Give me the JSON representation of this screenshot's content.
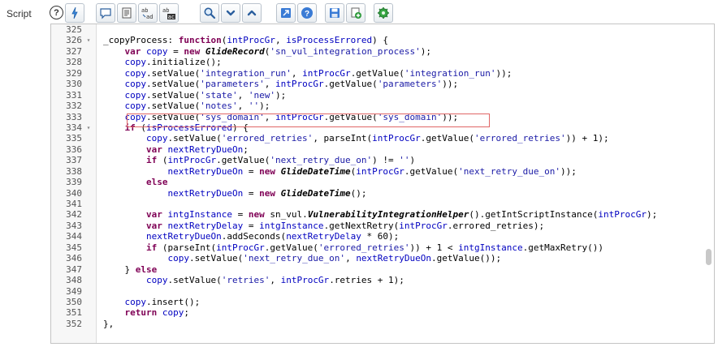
{
  "field_label": "Script",
  "toolbar": {
    "buttons": [
      {
        "name": "help-icon",
        "glyph": "?"
      },
      {
        "name": "format-code-icon"
      },
      {
        "name": "comment-icon"
      },
      {
        "name": "document-icon"
      },
      {
        "name": "replace-icon",
        "top": "ab",
        "bottom": "ad"
      },
      {
        "name": "replace-all-icon",
        "top": "ab",
        "bottom": "ac"
      },
      {
        "name": "search-icon"
      },
      {
        "name": "chevron-down-icon"
      },
      {
        "name": "chevron-up-icon"
      },
      {
        "name": "open-external-icon"
      },
      {
        "name": "help-circle-icon",
        "glyph": "?"
      },
      {
        "name": "save-icon"
      },
      {
        "name": "add-script-icon"
      },
      {
        "name": "gear-icon"
      }
    ]
  },
  "editor": {
    "highlighted_line": "333",
    "lines": [
      {
        "n": "325",
        "fold": false,
        "code": ""
      },
      {
        "n": "326",
        "fold": true,
        "code": "_copyProcess: function(intProcGr, isProcessErrored) {"
      },
      {
        "n": "327",
        "fold": false,
        "code": "    var copy = new GlideRecord('sn_vul_integration_process');"
      },
      {
        "n": "328",
        "fold": false,
        "code": "    copy.initialize();"
      },
      {
        "n": "329",
        "fold": false,
        "code": "    copy.setValue('integration_run', intProcGr.getValue('integration_run'));"
      },
      {
        "n": "330",
        "fold": false,
        "code": "    copy.setValue('parameters', intProcGr.getValue('parameters'));"
      },
      {
        "n": "331",
        "fold": false,
        "code": "    copy.setValue('state', 'new');"
      },
      {
        "n": "332",
        "fold": false,
        "code": "    copy.setValue('notes', '');"
      },
      {
        "n": "333",
        "fold": false,
        "code": "    copy.setValue('sys_domain', intProcGr.getValue('sys_domain'));"
      },
      {
        "n": "334",
        "fold": true,
        "code": "    if (isProcessErrored) {"
      },
      {
        "n": "335",
        "fold": false,
        "code": "        copy.setValue('errored_retries', parseInt(intProcGr.getValue('errored_retries')) + 1);"
      },
      {
        "n": "336",
        "fold": false,
        "code": "        var nextRetryDueOn;"
      },
      {
        "n": "337",
        "fold": false,
        "code": "        if (intProcGr.getValue('next_retry_due_on') != '')"
      },
      {
        "n": "338",
        "fold": false,
        "code": "            nextRetryDueOn = new GlideDateTime(intProcGr.getValue('next_retry_due_on'));"
      },
      {
        "n": "339",
        "fold": false,
        "code": "        else"
      },
      {
        "n": "340",
        "fold": false,
        "code": "            nextRetryDueOn = new GlideDateTime();"
      },
      {
        "n": "341",
        "fold": false,
        "code": ""
      },
      {
        "n": "342",
        "fold": false,
        "code": "        var intgInstance = new sn_vul.VulnerabilityIntegrationHelper().getIntScriptInstance(intProcGr);"
      },
      {
        "n": "343",
        "fold": false,
        "code": "        var nextRetryDelay = intgInstance.getNextRetry(intProcGr.errored_retries);"
      },
      {
        "n": "344",
        "fold": false,
        "code": "        nextRetryDueOn.addSeconds(nextRetryDelay * 60);"
      },
      {
        "n": "345",
        "fold": false,
        "code": "        if (parseInt(intProcGr.getValue('errored_retries')) + 1 < intgInstance.getMaxRetry())"
      },
      {
        "n": "346",
        "fold": false,
        "code": "            copy.setValue('next_retry_due_on', nextRetryDueOn.getValue());"
      },
      {
        "n": "347",
        "fold": false,
        "code": "    } else"
      },
      {
        "n": "348",
        "fold": false,
        "code": "        copy.setValue('retries', intProcGr.retries + 1);"
      },
      {
        "n": "349",
        "fold": false,
        "code": ""
      },
      {
        "n": "350",
        "fold": false,
        "code": "    copy.insert();"
      },
      {
        "n": "351",
        "fold": false,
        "code": "    return copy;"
      },
      {
        "n": "352",
        "fold": false,
        "code": "},"
      }
    ]
  },
  "colors": {
    "keyword": "#7f0055",
    "string": "#1a1aa6",
    "variable": "#0000c0",
    "highlight_border": "#e06666"
  }
}
